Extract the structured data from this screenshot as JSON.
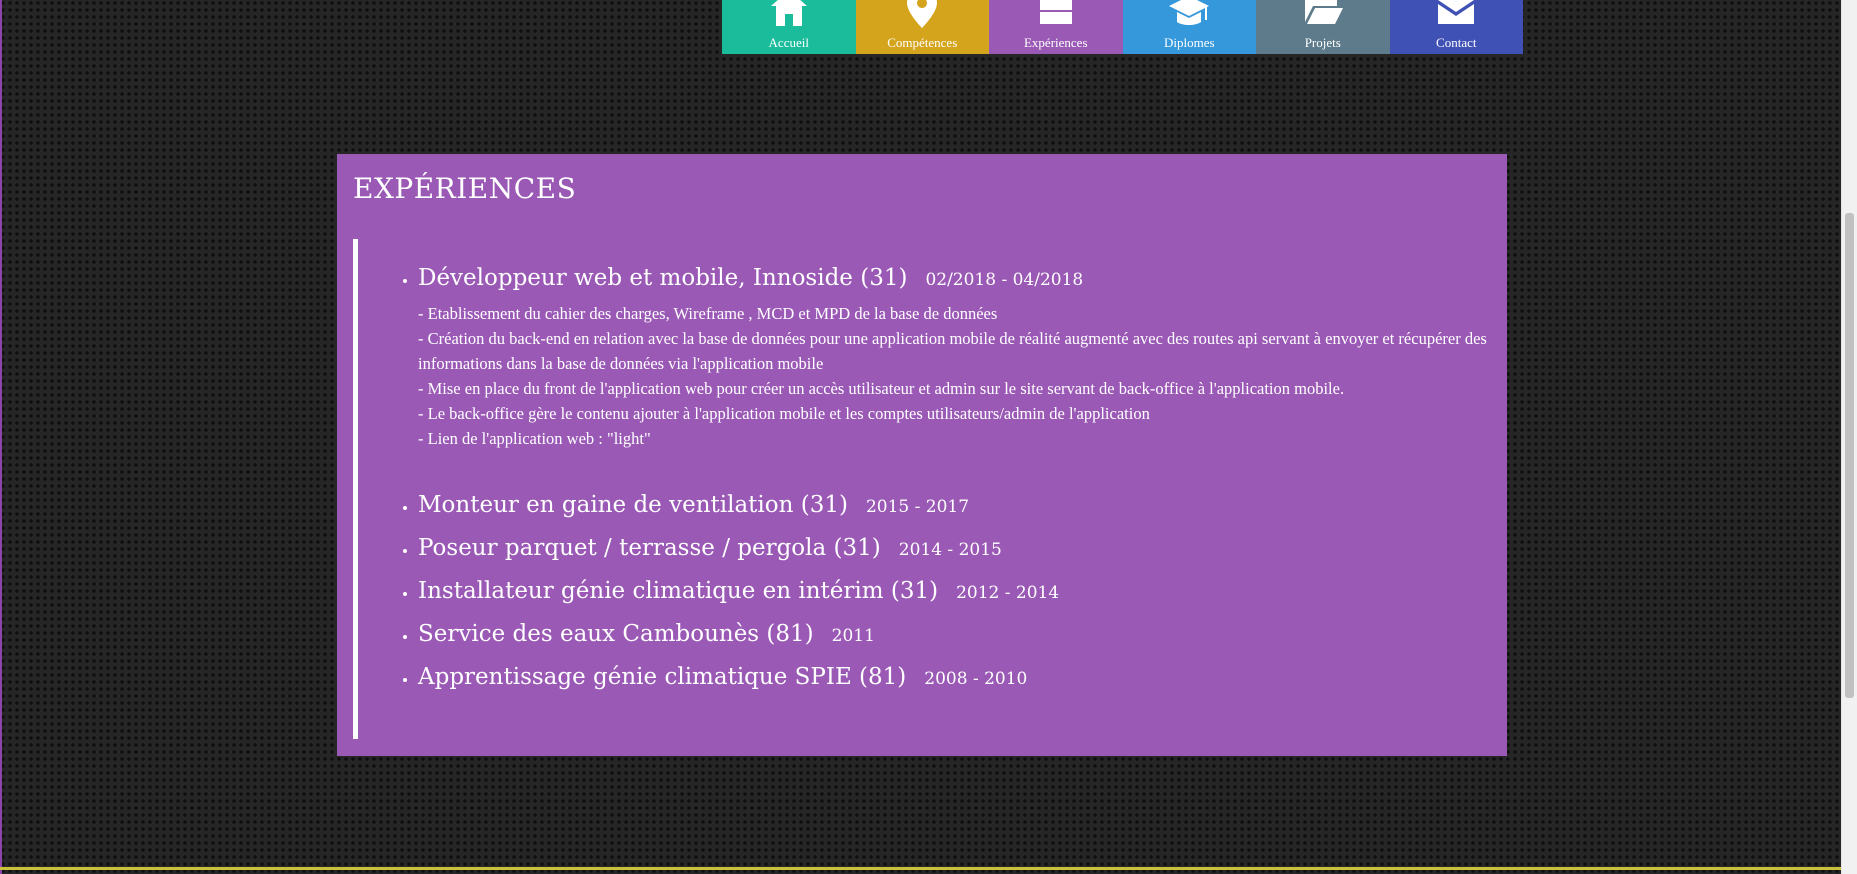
{
  "nav": {
    "items": [
      {
        "label": "Accueil",
        "icon": "home-icon",
        "color": "#1abc9c"
      },
      {
        "label": "Compétences",
        "icon": "map-pin-icon",
        "color": "#d4a41c"
      },
      {
        "label": "Expériences",
        "icon": "briefcase-icon",
        "color": "#9b59b6"
      },
      {
        "label": "Diplomes",
        "icon": "graduation-cap-icon",
        "color": "#3498db"
      },
      {
        "label": "Projets",
        "icon": "folder-open-icon",
        "color": "#5d7b8a"
      },
      {
        "label": "Contact",
        "icon": "envelope-icon",
        "color": "#3f51b5"
      }
    ]
  },
  "section": {
    "title": "EXPÉRIENCES",
    "experiences": [
      {
        "title": "Développeur web et mobile, Innoside (31)",
        "dates": "02/2018 - 04/2018",
        "description": [
          "- Etablissement du cahier des charges, Wireframe , MCD et MPD de la base de données",
          "- Création du back-end en relation avec la base de données pour une application mobile de réalité augmenté avec des routes api servant à envoyer et récupérer des informations dans la base de données via l'application mobile",
          "- Mise en place du front de l'application web pour créer un accès utilisateur et admin sur le site servant de back-office à l'application mobile.",
          "- Le back-office gère le contenu ajouter à l'application mobile et les comptes utilisateurs/admin de l'application",
          "- Lien de l'application web : \"light\""
        ]
      },
      {
        "title": "Monteur en gaine de ventilation (31)",
        "dates": "2015 - 2017"
      },
      {
        "title": "Poseur parquet / terrasse / pergola (31)",
        "dates": "2014 - 2015"
      },
      {
        "title": "Installateur génie climatique en intérim (31)",
        "dates": "2012 - 2014"
      },
      {
        "title": "Service des eaux Cambounès (81)",
        "dates": "2011"
      },
      {
        "title": "Apprentissage génie climatique SPIE (81)",
        "dates": "2008 - 2010"
      }
    ]
  },
  "colors": {
    "panel": "#9b59b6",
    "background": "#262626",
    "accent_bottom": "#c9c23a"
  }
}
